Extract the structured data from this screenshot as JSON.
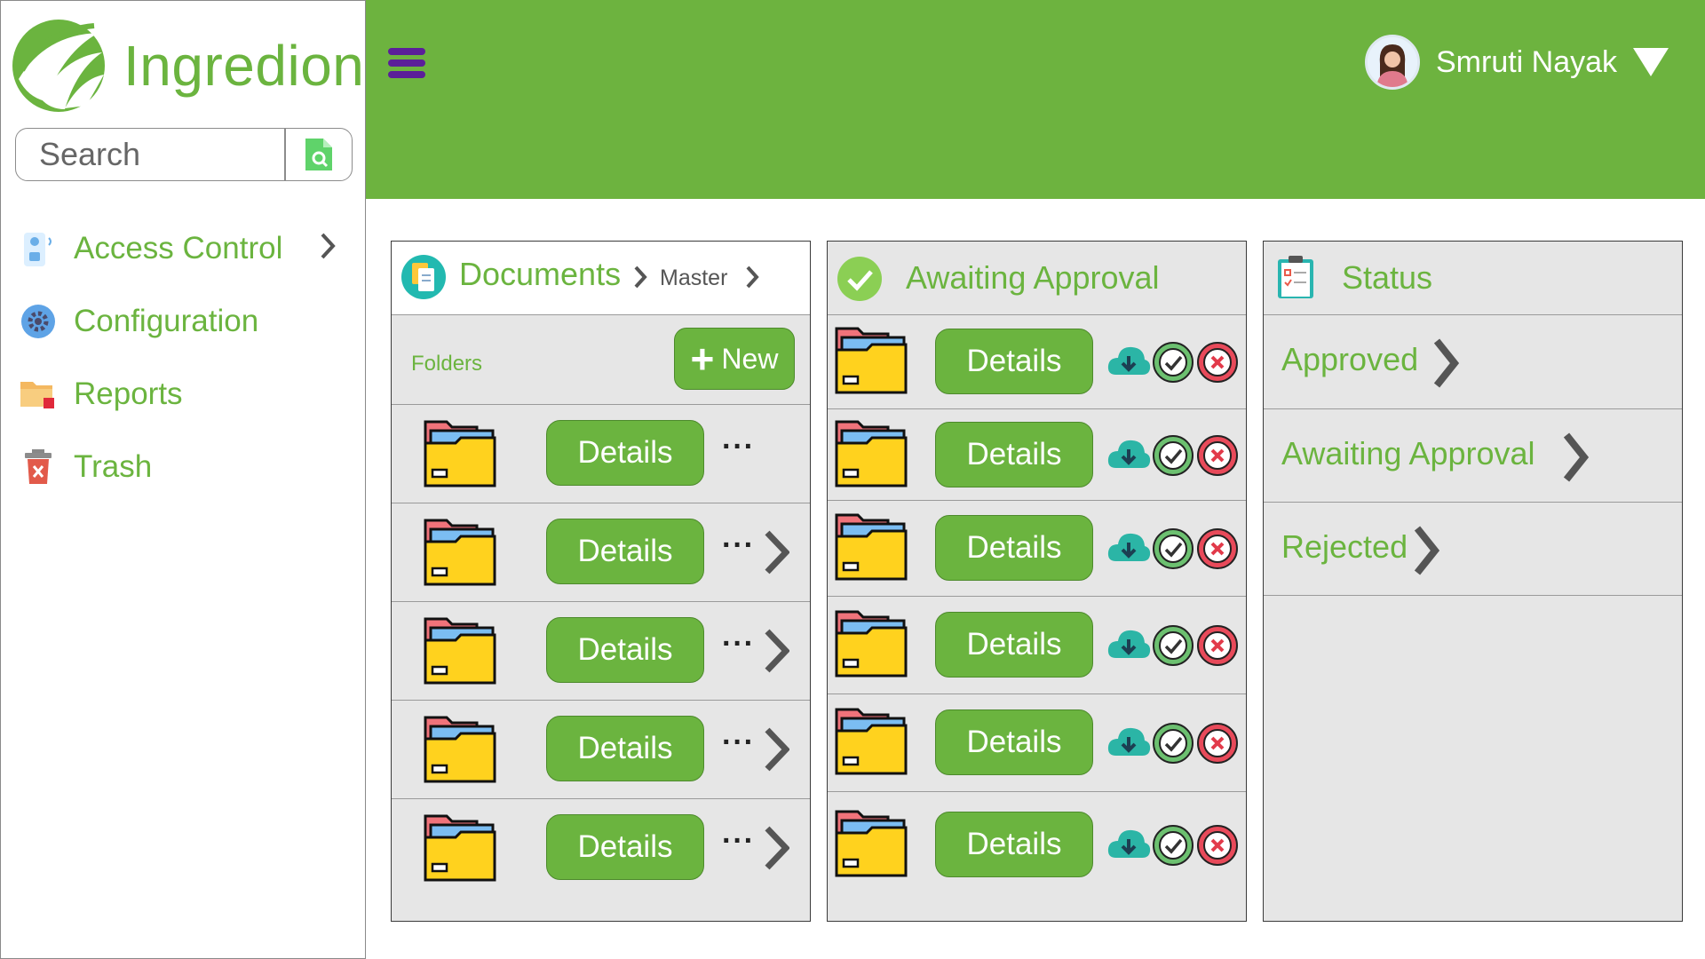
{
  "brand": {
    "name": "Ingredion"
  },
  "search": {
    "placeholder": "Search"
  },
  "sidebar": {
    "items": [
      {
        "label": "Access Control",
        "icon": "access-control-icon"
      },
      {
        "label": "Configuration",
        "icon": "gear-icon"
      },
      {
        "label": "Reports",
        "icon": "reports-folder-icon"
      },
      {
        "label": "Trash",
        "icon": "trash-icon"
      }
    ]
  },
  "header": {
    "user_name": "Smruti Nayak"
  },
  "documents": {
    "title": "Documents",
    "breadcrumb": "Master",
    "folders_label": "Folders",
    "new_label": "New",
    "rows": [
      {
        "button": "Details",
        "more": "···"
      },
      {
        "button": "Details",
        "more": "···"
      },
      {
        "button": "Details",
        "more": "···"
      },
      {
        "button": "Details",
        "more": "···"
      },
      {
        "button": "Details",
        "more": "···"
      }
    ]
  },
  "awaiting": {
    "title": "Awaiting Approval",
    "rows": [
      {
        "button": "Details"
      },
      {
        "button": "Details"
      },
      {
        "button": "Details"
      },
      {
        "button": "Details"
      },
      {
        "button": "Details"
      },
      {
        "button": "Details"
      }
    ]
  },
  "status": {
    "title": "Status",
    "items": [
      {
        "label": "Approved"
      },
      {
        "label": "Awaiting Approval"
      },
      {
        "label": "Rejected"
      }
    ]
  },
  "colors": {
    "brand_green": "#6bb43f",
    "header_green": "#6db33f",
    "hamburger_purple": "#5b1f99",
    "panel_bg": "#e6e6e6"
  }
}
